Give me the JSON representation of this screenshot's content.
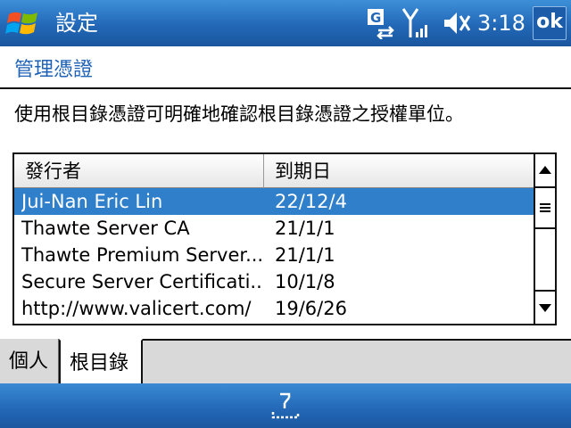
{
  "titlebar": {
    "title": "設定",
    "clock": "3:18",
    "ok_label": "ok",
    "icons": [
      "windows-start-icon",
      "connectivity-icon",
      "signal-icon",
      "volume-icon"
    ]
  },
  "page": {
    "heading": "管理憑證",
    "description": "使用根目錄憑證可明確地確認根目錄憑證之授權單位。"
  },
  "cert_list": {
    "columns": {
      "issuer": "發行者",
      "expiry": "到期日"
    },
    "rows": [
      {
        "issuer": "Jui-Nan Eric Lin",
        "expiry": "22/12/4",
        "selected": true
      },
      {
        "issuer": "Thawte Server CA",
        "expiry": "21/1/1",
        "selected": false
      },
      {
        "issuer": "Thawte Premium Server...",
        "expiry": "21/1/1",
        "selected": false
      },
      {
        "issuer": "Secure Server Certificati...",
        "expiry": "10/1/8",
        "selected": false
      },
      {
        "issuer": "http://www.valicert.com/",
        "expiry": "19/6/26",
        "selected": false
      }
    ]
  },
  "tabs": [
    {
      "label": "個人",
      "active": false
    },
    {
      "label": "根目錄",
      "active": true
    }
  ],
  "softbar": {
    "icons": [
      "keyboard-input-icon"
    ]
  },
  "colors": {
    "titlebar": "#2268b7",
    "heading": "#1f62b6",
    "selection": "#2f7fcb",
    "tab_strip": "#d9d9d9"
  }
}
